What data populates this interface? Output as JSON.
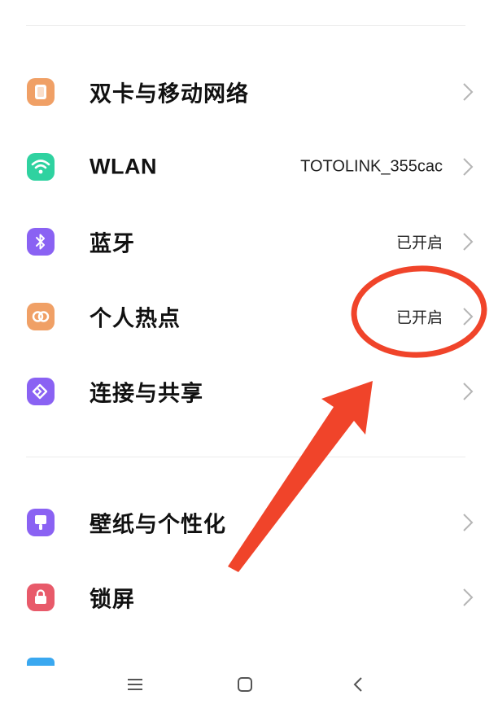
{
  "settings": {
    "items": [
      {
        "label": "双卡与移动网络",
        "value": "",
        "icon": "sim-card-icon",
        "icon_color": "#f0a066"
      },
      {
        "label": "WLAN",
        "value": "TOTOLINK_355cac",
        "icon": "wifi-icon",
        "icon_color": "#2fd2a0"
      },
      {
        "label": "蓝牙",
        "value": "已开启",
        "icon": "bluetooth-icon",
        "icon_color": "#8a62f3"
      },
      {
        "label": "个人热点",
        "value": "已开启",
        "icon": "hotspot-icon",
        "icon_color": "#f0a066"
      },
      {
        "label": "连接与共享",
        "value": "",
        "icon": "connection-share-icon",
        "icon_color": "#8a62f3"
      },
      {
        "label": "壁纸与个性化",
        "value": "",
        "icon": "wallpaper-icon",
        "icon_color": "#8a62f3"
      },
      {
        "label": "锁屏",
        "value": "",
        "icon": "lock-screen-icon",
        "icon_color": "#e85a6a"
      }
    ]
  },
  "annotation": {
    "color": "#f0442a"
  },
  "navbar": {
    "menu_icon": "menu-icon",
    "home_icon": "home-icon",
    "back_icon": "back-icon"
  }
}
